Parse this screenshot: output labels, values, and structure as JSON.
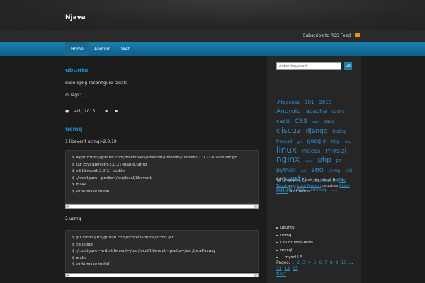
{
  "site": {
    "title": "Njava",
    "rss_label": "Subscribe to RSS Feed"
  },
  "nav": {
    "items": [
      "Home",
      "Android",
      "Web"
    ]
  },
  "posts": [
    {
      "title": "ubuntu",
      "body": "sudo dpkg-reconfigure tzdata",
      "tags_label": "Tags: ,",
      "date": "4th, 2015"
    },
    {
      "title": "ucmq",
      "intro1": "1 libevent ucmq>2.0.10",
      "intro2": "2 ucmq"
    }
  ],
  "code_block_1": {
    "lines": [
      "$ wget https://github.com/downloads/libevent/libevent/libevent-2.0.21-stable.tar.gz",
      "$ tar zxvf libevent-2.0.21-stable.tar.gz",
      "$ cd libevent-2.0.21-stable",
      "$ ./configure --prefix=/usr/local/libevent",
      "$ make",
      "$ sudo make install"
    ]
  },
  "code_block_2": {
    "lines": [
      "$ git clone git://github.com/ucopensource/ucmq.git",
      "$ cd ucmq",
      "$ ./configure --with-libevent=/usr/local/libevent --prefix=/usr/local/ucmq",
      "$ make",
      "$ sudo make install"
    ]
  },
  "sidebar": {
    "search_placeholder": "enter keyword...",
    "search_button": "Go",
    "tags": [
      {
        "t": ".htaccess",
        "s": 7
      },
      {
        "t": "301",
        "s": 7
      },
      {
        "t": "2010",
        "s": 7
      },
      {
        "t": "Android",
        "s": 9
      },
      {
        "t": "apache",
        "s": 8
      },
      {
        "t": "cache",
        "s": 6
      },
      {
        "t": "cacti",
        "s": 8
      },
      {
        "t": "CSS",
        "s": 9
      },
      {
        "t": "date",
        "s": 4
      },
      {
        "t": "ddos",
        "s": 6
      },
      {
        "t": "discuz",
        "s": 11
      },
      {
        "t": "django",
        "s": 9
      },
      {
        "t": "fastcgi",
        "s": 6
      },
      {
        "t": "freebsd",
        "s": 6
      },
      {
        "t": "git",
        "s": 5
      },
      {
        "t": "google",
        "s": 8
      },
      {
        "t": "http",
        "s": 6
      },
      {
        "t": "iftop",
        "s": 4
      },
      {
        "t": "linux",
        "s": 12
      },
      {
        "t": "macos",
        "s": 8
      },
      {
        "t": "mysql",
        "s": 10
      },
      {
        "t": "nginx",
        "s": 12
      },
      {
        "t": "nload",
        "s": 4
      },
      {
        "t": "php",
        "s": 10
      },
      {
        "t": "pr",
        "s": 7
      },
      {
        "t": "python",
        "s": 8
      },
      {
        "t": "qsd",
        "s": 4
      },
      {
        "t": "seo",
        "s": 10
      },
      {
        "t": "snmp",
        "s": 6
      },
      {
        "t": "ssh",
        "s": 6
      },
      {
        "t": "ubuntu",
        "s": 12
      },
      {
        "t": "ubuntu10.04",
        "s": 7
      },
      {
        "t": "wordpress",
        "s": 8
      },
      {
        "t": "xdebug",
        "s": 6
      },
      {
        "t": "ucmq",
        "s": 3
      }
    ],
    "tagcloud_text": "WP Cumulus Flash tag cloud by",
    "tagcloud_author1": "Roy Tanck",
    "tagcloud_and": "and",
    "tagcloud_author2": "Luke Morton",
    "tagcloud_requires": "requires",
    "tagcloud_flash": "Flash Player",
    "tagcloud_end": "9 or better.",
    "categories": [
      "ubuntu",
      "ucmq",
      "Ubuntuphp-redis",
      "mysql",
      "mysql5.5"
    ],
    "pages_label": "Pages:",
    "pages": [
      "1",
      "2",
      "3",
      "4",
      "5",
      "6",
      "7",
      "8",
      "9",
      "10",
      "...",
      "13",
      "14",
      "15"
    ],
    "next_label": "Next"
  },
  "colors": {
    "accent": "#1b87c2",
    "nav": "#1a7fb0",
    "rss": "#f28a1c"
  }
}
